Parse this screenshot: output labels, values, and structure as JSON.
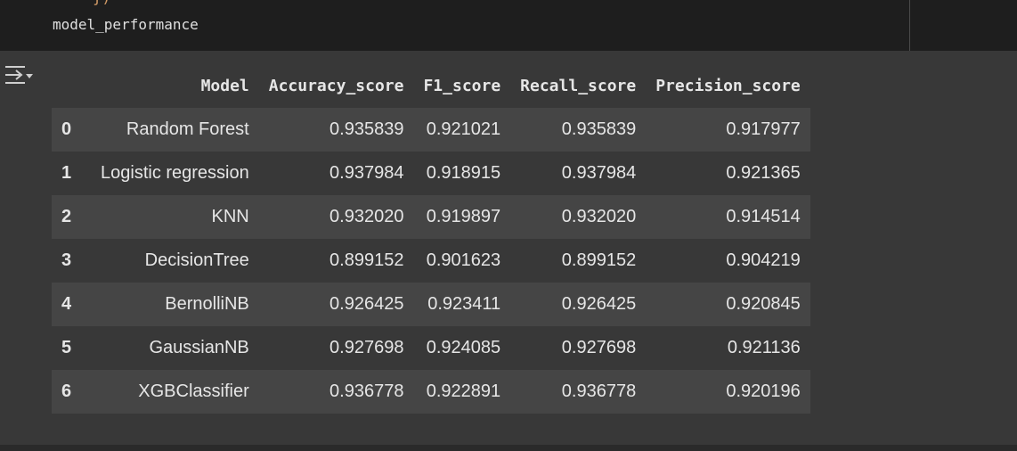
{
  "code": {
    "prev_fragment": "})",
    "line": "model_performance"
  },
  "output": {
    "toggle_icon": "output-collapse-icon",
    "table": {
      "columns": [
        "",
        "Model",
        "Accuracy_score",
        "F1_score",
        "Recall_score",
        "Precision_score"
      ],
      "rows": [
        {
          "index": "0",
          "model": "Random Forest",
          "accuracy": "0.935839",
          "f1": "0.921021",
          "recall": "0.935839",
          "precision": "0.917977"
        },
        {
          "index": "1",
          "model": "Logistic regression",
          "accuracy": "0.937984",
          "f1": "0.918915",
          "recall": "0.937984",
          "precision": "0.921365"
        },
        {
          "index": "2",
          "model": "KNN",
          "accuracy": "0.932020",
          "f1": "0.919897",
          "recall": "0.932020",
          "precision": "0.914514"
        },
        {
          "index": "3",
          "model": "DecisionTree",
          "accuracy": "0.899152",
          "f1": "0.901623",
          "recall": "0.899152",
          "precision": "0.904219"
        },
        {
          "index": "4",
          "model": "BernolliNB",
          "accuracy": "0.926425",
          "f1": "0.923411",
          "recall": "0.926425",
          "precision": "0.920845"
        },
        {
          "index": "5",
          "model": "GaussianNB",
          "accuracy": "0.927698",
          "f1": "0.924085",
          "recall": "0.927698",
          "precision": "0.921136"
        },
        {
          "index": "6",
          "model": "XGBClassifier",
          "accuracy": "0.936778",
          "f1": "0.922891",
          "recall": "0.936778",
          "precision": "0.920196"
        }
      ]
    }
  },
  "colors": {
    "code_bg": "#1e1e1e",
    "output_bg": "#383838",
    "row_stripe": "#454545",
    "text": "#e6e6e6"
  }
}
